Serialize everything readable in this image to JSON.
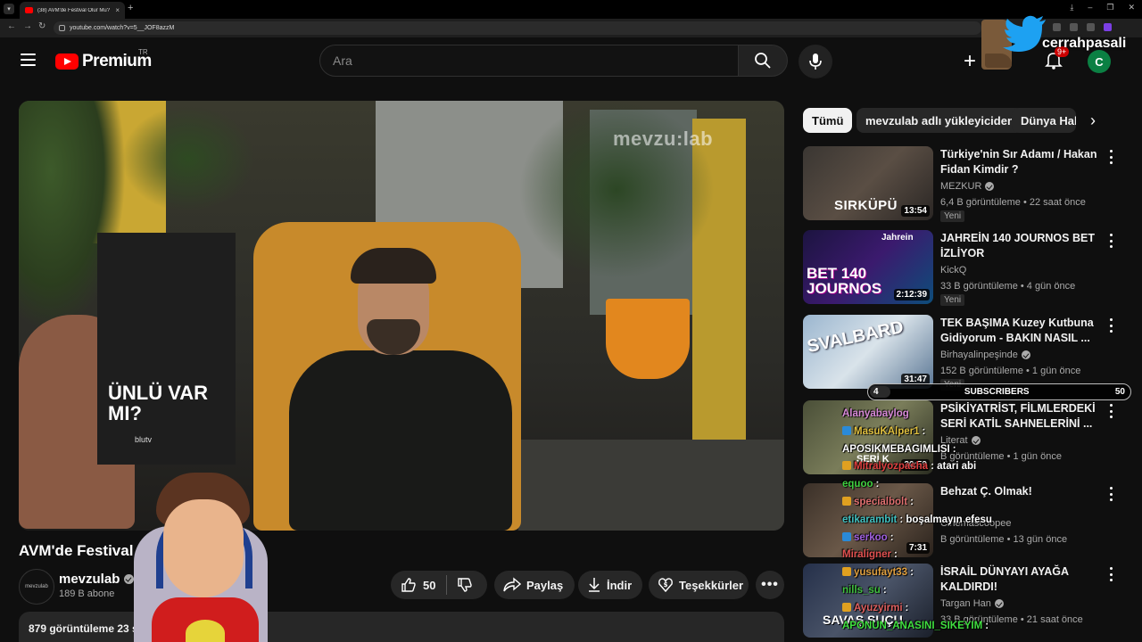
{
  "browser": {
    "tab_title": "(38) AVM'de Festival Olur Mu? ...",
    "url": "youtube.com/watch?v=5__JOF8azzM"
  },
  "header": {
    "logo_text": "Premium",
    "logo_region": "TR",
    "search_placeholder": "Ara",
    "notifications_badge": "9+",
    "avatar_letter": "C"
  },
  "overlay": {
    "handle": "cerrahpasali",
    "subscribers_label": "SUBSCRIBERS",
    "subscribers_current": "4",
    "subscribers_goal": "50",
    "subscribers_progress": 0.08
  },
  "video": {
    "watermark": "mevzu:lab",
    "poster_text": "ÜNLÜ VAR MI?",
    "poster_sub": "blutv",
    "title": "AVM'de Festival",
    "channel": "mevzulab",
    "channel_avatar_text": "mevzulab",
    "subscribers": "189 B abone",
    "likes": "50",
    "share_label": "Paylaş",
    "download_label": "İndir",
    "thanks_label": "Teşekkürler",
    "more_label": "•••",
    "stats": "879 görüntüleme  23 sa"
  },
  "chips": [
    "Tümü",
    "mevzulab adlı yükleyiciden",
    "Dünya Haberleri"
  ],
  "recommendations": [
    {
      "title": "Türkiye'nin Sır Adamı / Hakan Fidan Kimdir ?",
      "channel": "MEZKUR",
      "verified": true,
      "meta": "6,4 B görüntüleme • 22 saat önce",
      "badge": "Yeni",
      "duration": "13:54",
      "thumb_text": "SIRKÜPÜ"
    },
    {
      "title": "JAHREİN 140 JOURNOS BET İZLİYOR",
      "channel": "KickQ",
      "verified": false,
      "meta": "33 B görüntüleme • 4 gün önce",
      "badge": "Yeni",
      "duration": "2:12:39",
      "thumb_text": "BET 140 JOURNOS",
      "thumb_tag": "Jahrein"
    },
    {
      "title": "TEK BAŞIMA Kuzey Kutbuna Gidiyorum - BAKIN NASIL ...",
      "channel": "Birhayalinpeşinde",
      "verified": true,
      "meta": "152 B görüntüleme • 1 gün önce",
      "badge": "Yeni",
      "duration": "31:47",
      "thumb_text": "SVALBARD"
    },
    {
      "title": "PSİKİYATRİST, FİLMLERDEKİ SERİ KATİL SAHNELERİNİ ...",
      "channel": "Literat",
      "verified": true,
      "meta": "B görüntüleme • 1 gün önce",
      "badge": "",
      "duration": "20:59",
      "thumb_text": "SERİ K"
    },
    {
      "title": "Behzat Ç. Olmak!",
      "channel": "Cinemascoopee",
      "verified": false,
      "meta": "B görüntüleme • 13 gün önce",
      "badge": "",
      "duration": "7:31",
      "thumb_text": ""
    },
    {
      "title": "İSRAİL DÜNYAYI AYAĞA KALDIRDI!",
      "channel": "Targan Han",
      "verified": true,
      "meta": "33 B görüntüleme • 21 saat önce",
      "badge": "",
      "duration": "",
      "thumb_text": "SAVAŞ SUÇU"
    }
  ],
  "chat": [
    {
      "user": "Alanyabaylog",
      "text": "",
      "color": "#d88ad8"
    },
    {
      "user": "MasuKAlper1",
      "text": ":",
      "color": "#e0c040"
    },
    {
      "user": "APOSIKMEBAGIMLISI",
      "text": ":",
      "color": "#ffffff"
    },
    {
      "user": "Mitralyozpasha",
      "text": ": atari abi",
      "color": "#e04040"
    },
    {
      "user": "equoo",
      "text": ":",
      "color": "#40d040"
    },
    {
      "user": "specialbolt",
      "text": ":",
      "color": "#e07070"
    },
    {
      "user": "etikarambit",
      "text": ": boşalmayın efesu",
      "color": "#40c0c0"
    },
    {
      "user": "serkoo",
      "text": ":",
      "color": "#a060e0"
    },
    {
      "user": "Miraligner",
      "text": ":",
      "color": "#e05050"
    },
    {
      "user": "yusufayt33",
      "text": ":",
      "color": "#e0a040"
    },
    {
      "user": "nills_su",
      "text": ":",
      "color": "#40c040"
    },
    {
      "user": "Ayuzyirmi",
      "text": ":",
      "color": "#e06060"
    },
    {
      "user": "APONUN_ANASINI_SIKEYIM",
      "text": ":",
      "color": "#40e040"
    }
  ]
}
